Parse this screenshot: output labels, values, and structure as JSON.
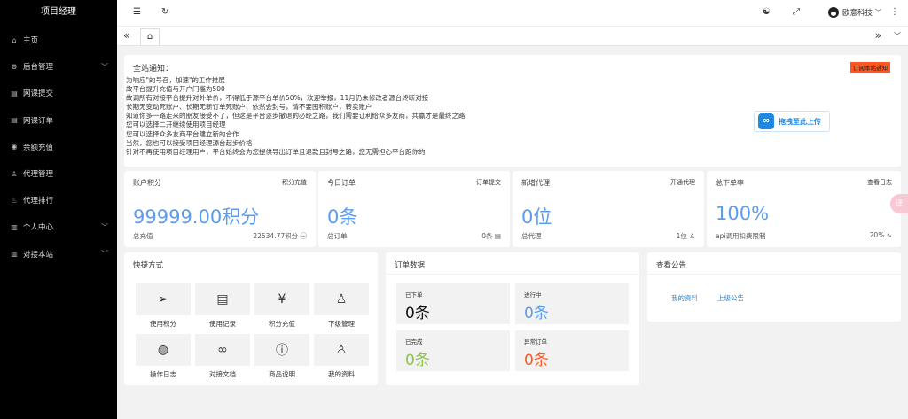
{
  "sidebar": {
    "title": "项目经理",
    "items": [
      {
        "icon": "⌂",
        "label": "主页",
        "arrow": ""
      },
      {
        "icon": "⚙",
        "label": "后台管理",
        "arrow": "﹀"
      },
      {
        "icon": "▤",
        "label": "网课提交",
        "arrow": ""
      },
      {
        "icon": "▤",
        "label": "网课订单",
        "arrow": ""
      },
      {
        "icon": "◉",
        "label": "余额充值",
        "arrow": ""
      },
      {
        "icon": "♙",
        "label": "代理管理",
        "arrow": ""
      },
      {
        "icon": "♨",
        "label": "代理排行",
        "arrow": ""
      },
      {
        "icon": "▥",
        "label": "个人中心",
        "arrow": "﹀"
      },
      {
        "icon": "▥",
        "label": "对接本站",
        "arrow": "﹀"
      }
    ]
  },
  "topbar": {
    "menu_icon": "☰",
    "refresh_icon": "↻",
    "theme_icon": "☯",
    "fullscreen_icon": "⤢",
    "user_name": "欧意科技",
    "user_caret": "﹀",
    "more_icon": "⋮"
  },
  "tabs": {
    "left_arrow": "«",
    "home_icon": "⌂",
    "right_arrow": "»",
    "down_arrow": "﹀"
  },
  "notice": {
    "title": "全站通知：",
    "badge": "订阅本站通知",
    "lines": [
      "为响应\"的号召，加速\"的工作推展",
      "故平台提升充值与开户门槛为500",
      "故调所有对接平台提升对外单价，不得低于源平台单价50%，欢迎举报，11月仍未修改者源台终断对接",
      "长期无变动死账户、长期无新订单死账户、依然会封号，请不要囤积账户，转卖账户",
      "知道你多一路走来的朋友接受不了，但这是平台逐步撤退的必经之路，我们需要让利给众多友商，共赢才是最终之路",
      "您可以选择二开继续使用项目经理",
      "您可以选择众多友商平台建立新的合作",
      "当然，您也可以接受项目经理源台起步价格",
      "针对不再使用项目经理用户，平台始终会为您提供导出订单且退款且封号之路，您无需担心平台跑你的"
    ],
    "upload_label": "拖拽至此上传"
  },
  "stats": [
    {
      "head": "账户积分",
      "link": "积分充值",
      "value": "99999.00积分",
      "foot_l": "总充值",
      "foot_r": "22534.77积分 ㊀"
    },
    {
      "head": "今日订单",
      "link": "订单提交",
      "value": "0条",
      "foot_l": "总订单",
      "foot_r": "0条 ▤"
    },
    {
      "head": "新增代理",
      "link": "开通代理",
      "value": "0位",
      "foot_l": "总代理",
      "foot_r": "1位 ♙"
    },
    {
      "head": "总下单率",
      "link": "查看日志",
      "value": "100%",
      "foot_l": "api调用扣费限制",
      "foot_r": "20% ∿"
    }
  ],
  "quick": {
    "title": "快捷方式",
    "items": [
      {
        "icon": "➢",
        "label": "使用积分"
      },
      {
        "icon": "▤",
        "label": "使用记录"
      },
      {
        "icon": "¥",
        "label": "积分充值"
      },
      {
        "icon": "♙",
        "label": "下级管理"
      },
      {
        "icon": "◍",
        "label": "操作日志"
      },
      {
        "icon": "∞",
        "label": "对接文档"
      },
      {
        "icon": "ⓘ",
        "label": "商品说明"
      },
      {
        "icon": "♙",
        "label": "我的资料"
      }
    ]
  },
  "orders": {
    "title": "订单数据",
    "items": [
      {
        "label": "已下单",
        "value": "0条",
        "color": "#111111"
      },
      {
        "label": "进行中",
        "value": "0条",
        "color": "#5b9bf0"
      },
      {
        "label": "已完成",
        "value": "0条",
        "color": "#8bc34a"
      },
      {
        "label": "异常订单",
        "value": "0条",
        "color": "#ff5722"
      }
    ]
  },
  "announce": {
    "title": "查看公告",
    "links": [
      "我的资料",
      "上级公告"
    ]
  },
  "side_bubble": "译"
}
